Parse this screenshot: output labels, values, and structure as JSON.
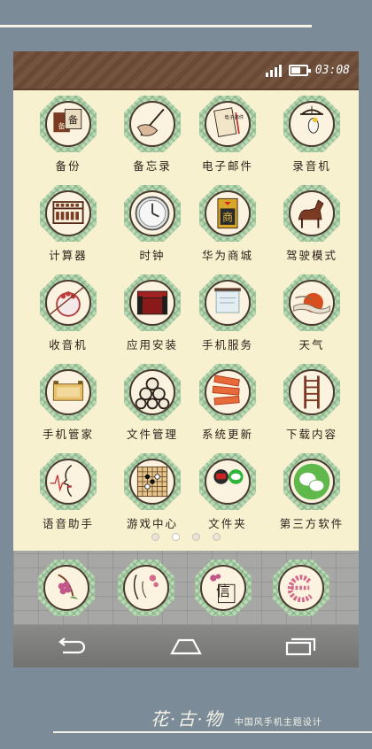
{
  "status": {
    "time": "03:08",
    "battery_level": 0.55,
    "signal_bars": 4
  },
  "apps": [
    {
      "label": "备份",
      "icon": "backup-icon"
    },
    {
      "label": "备忘录",
      "icon": "brush-memo-icon"
    },
    {
      "label": "电子邮件",
      "icon": "letter-icon"
    },
    {
      "label": "录音机",
      "icon": "bird-cage-icon"
    },
    {
      "label": "计算器",
      "icon": "abacus-icon"
    },
    {
      "label": "时钟",
      "icon": "clock-icon"
    },
    {
      "label": "华为商城",
      "icon": "shop-sign-icon"
    },
    {
      "label": "驾驶模式",
      "icon": "horse-icon"
    },
    {
      "label": "收音机",
      "icon": "opera-mask-icon"
    },
    {
      "label": "应用安装",
      "icon": "chest-icon"
    },
    {
      "label": "手机服务",
      "icon": "scroll-icon"
    },
    {
      "label": "天气",
      "icon": "sun-cloud-icon"
    },
    {
      "label": "手机管家",
      "icon": "box-icon"
    },
    {
      "label": "文件管理",
      "icon": "coins-icon"
    },
    {
      "label": "系统更新",
      "icon": "fan-icon"
    },
    {
      "label": "下载内容",
      "icon": "ladder-icon"
    },
    {
      "label": "语音助手",
      "icon": "face-profile-icon"
    },
    {
      "label": "游戏中心",
      "icon": "go-board-icon"
    },
    {
      "label": "文件夹",
      "icon": "folder-icon"
    },
    {
      "label": "第三方软件",
      "icon": "wechat-icon"
    }
  ],
  "pager": {
    "pages": 4,
    "active": 1
  },
  "dock": [
    {
      "icon": "phone-flower-icon"
    },
    {
      "icon": "contacts-lady-icon"
    },
    {
      "icon": "messages-letter-icon",
      "text": "信"
    },
    {
      "icon": "browser-flower-e-icon"
    }
  ],
  "footer": {
    "brand": "花·古·物",
    "tagline": "中国风手机主题设计"
  }
}
